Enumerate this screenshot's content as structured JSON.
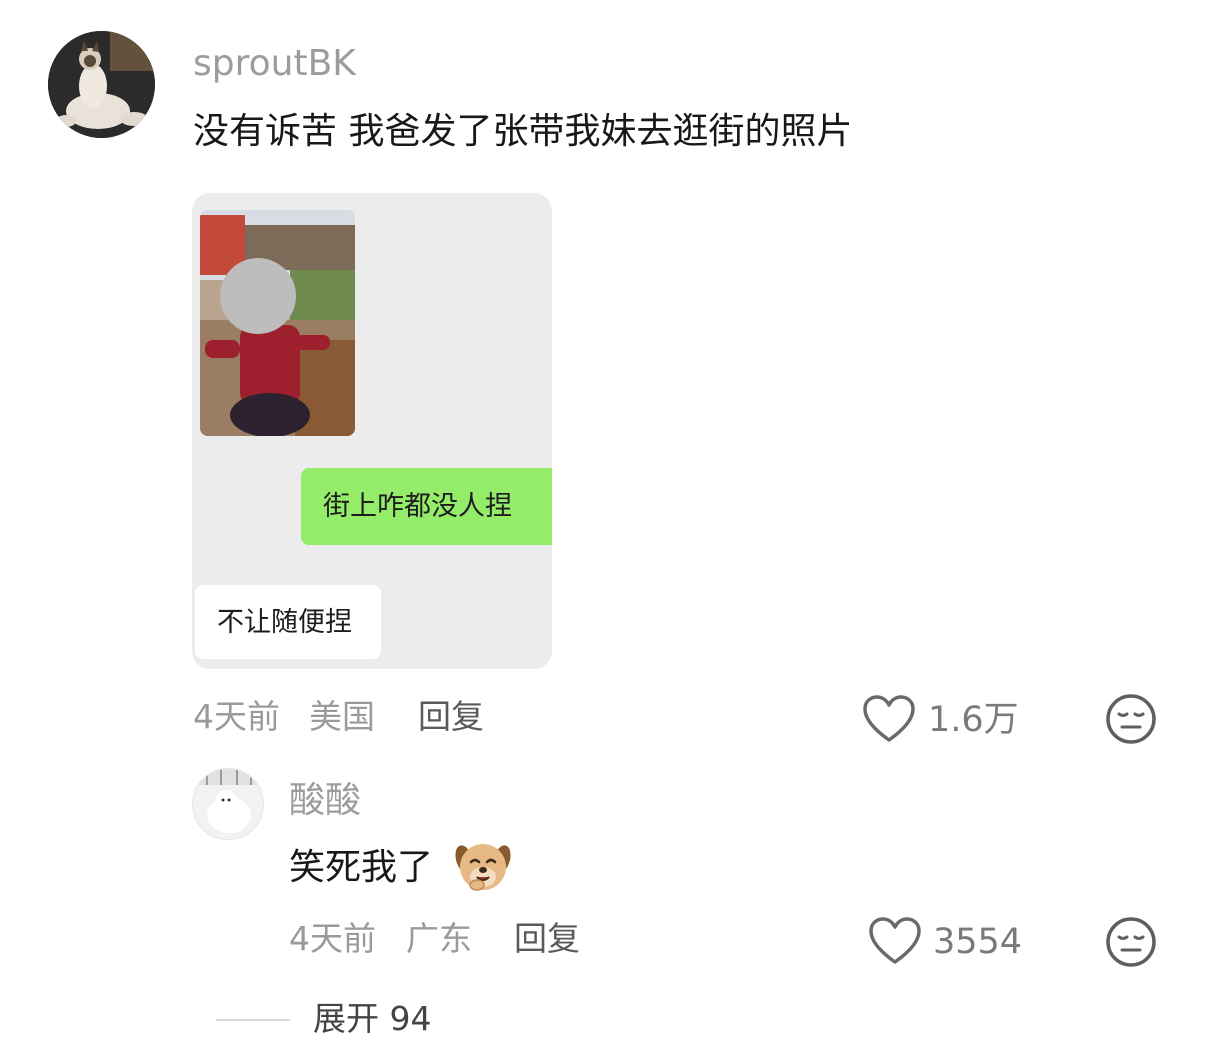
{
  "comment": {
    "username": "sproutBK",
    "text": "没有诉苦 我爸发了张带我妹去逛街的照片",
    "image": {
      "sent_message": "街上咋都没人捏",
      "received_message": "不让随便捏"
    },
    "time": "4天前",
    "location": "美国",
    "reply_label": "回复",
    "like_count": "1.6万"
  },
  "reply": {
    "username": "酸酸",
    "text": "笑死我了",
    "time": "4天前",
    "location": "广东",
    "reply_label": "回复",
    "like_count": "3554"
  },
  "expand": {
    "label": "展开 94"
  },
  "icons": {
    "like": "heart-outline-icon",
    "dislike": "meh-face-icon",
    "sticker": "puppy-laughing-emoji"
  },
  "colors": {
    "sent_bubble": "#95ec69",
    "chat_background": "#ececec",
    "username": "#9c9c9c"
  }
}
